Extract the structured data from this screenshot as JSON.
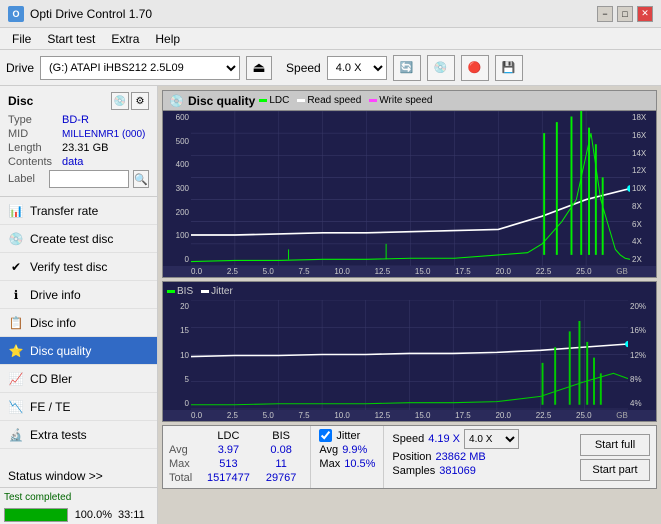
{
  "app": {
    "title": "Opti Drive Control 1.70",
    "icon_label": "O"
  },
  "title_controls": {
    "minimize": "−",
    "maximize": "□",
    "close": "✕"
  },
  "menu": {
    "items": [
      "File",
      "Start test",
      "Extra",
      "Help"
    ]
  },
  "toolbar": {
    "drive_label": "Drive",
    "drive_value": "(G:)  ATAPI iHBS212  2.5L09",
    "speed_label": "Speed",
    "speed_value": "4.0 X"
  },
  "disc": {
    "section_title": "Disc",
    "type_label": "Type",
    "type_value": "BD-R",
    "mid_label": "MID",
    "mid_value": "MILLENMR1 (000)",
    "length_label": "Length",
    "length_value": "23.31 GB",
    "contents_label": "Contents",
    "contents_value": "data",
    "label_label": "Label",
    "label_value": ""
  },
  "nav": {
    "items": [
      {
        "id": "transfer-rate",
        "label": "Transfer rate",
        "icon": "📊"
      },
      {
        "id": "create-test-disc",
        "label": "Create test disc",
        "icon": "💿"
      },
      {
        "id": "verify-test-disc",
        "label": "Verify test disc",
        "icon": "✔"
      },
      {
        "id": "drive-info",
        "label": "Drive info",
        "icon": "ℹ"
      },
      {
        "id": "disc-info",
        "label": "Disc info",
        "icon": "📋"
      },
      {
        "id": "disc-quality",
        "label": "Disc quality",
        "icon": "⭐",
        "active": true
      },
      {
        "id": "cd-bler",
        "label": "CD Bler",
        "icon": "📈"
      },
      {
        "id": "fe-te",
        "label": "FE / TE",
        "icon": "📉"
      },
      {
        "id": "extra-tests",
        "label": "Extra tests",
        "icon": "🔬"
      }
    ]
  },
  "status_window_btn": "Status window >>",
  "progress": {
    "value": 100,
    "text": "100.0%",
    "time": "33:11"
  },
  "status_text": "Test completed",
  "chart_top": {
    "title": "Disc quality",
    "legend": [
      {
        "label": "LDC",
        "color": "#00ff00"
      },
      {
        "label": "Read speed",
        "color": "#ffffff"
      },
      {
        "label": "Write speed",
        "color": "#ff44ff"
      }
    ],
    "y_axis": [
      "600",
      "500",
      "400",
      "300",
      "200",
      "100",
      "0"
    ],
    "y_axis_right": [
      "18X",
      "16X",
      "14X",
      "12X",
      "10X",
      "8X",
      "6X",
      "4X",
      "2X"
    ],
    "x_axis": [
      "0.0",
      "2.5",
      "5.0",
      "7.5",
      "10.0",
      "12.5",
      "15.0",
      "17.5",
      "20.0",
      "22.5",
      "25.0"
    ],
    "x_label": "GB"
  },
  "chart_bottom": {
    "legend": [
      {
        "label": "BIS",
        "color": "#00ff00"
      },
      {
        "label": "Jitter",
        "color": "#ffffff"
      }
    ],
    "y_axis": [
      "20",
      "15",
      "10",
      "5",
      "0"
    ],
    "y_axis_right": [
      "20%",
      "16%",
      "12%",
      "8%",
      "4%"
    ],
    "x_axis": [
      "0.0",
      "2.5",
      "5.0",
      "7.5",
      "10.0",
      "12.5",
      "15.0",
      "17.5",
      "20.0",
      "22.5",
      "25.0"
    ]
  },
  "stats": {
    "columns": [
      "LDC",
      "BIS"
    ],
    "rows": [
      {
        "label": "Avg",
        "ldc": "3.97",
        "bis": "0.08"
      },
      {
        "label": "Max",
        "ldc": "513",
        "bis": "11"
      },
      {
        "label": "Total",
        "ldc": "1517477",
        "bis": "29767"
      }
    ],
    "jitter": {
      "label": "Jitter",
      "checked": true,
      "avg": "9.9%",
      "max": "10.5%",
      "samples": "381069"
    },
    "speed": {
      "label": "Speed",
      "value": "4.19 X",
      "select": "4.0 X",
      "position_label": "Position",
      "position_value": "23862 MB",
      "samples_label": "Samples",
      "samples_value": "381069"
    },
    "buttons": {
      "start_full": "Start full",
      "start_part": "Start part"
    }
  }
}
